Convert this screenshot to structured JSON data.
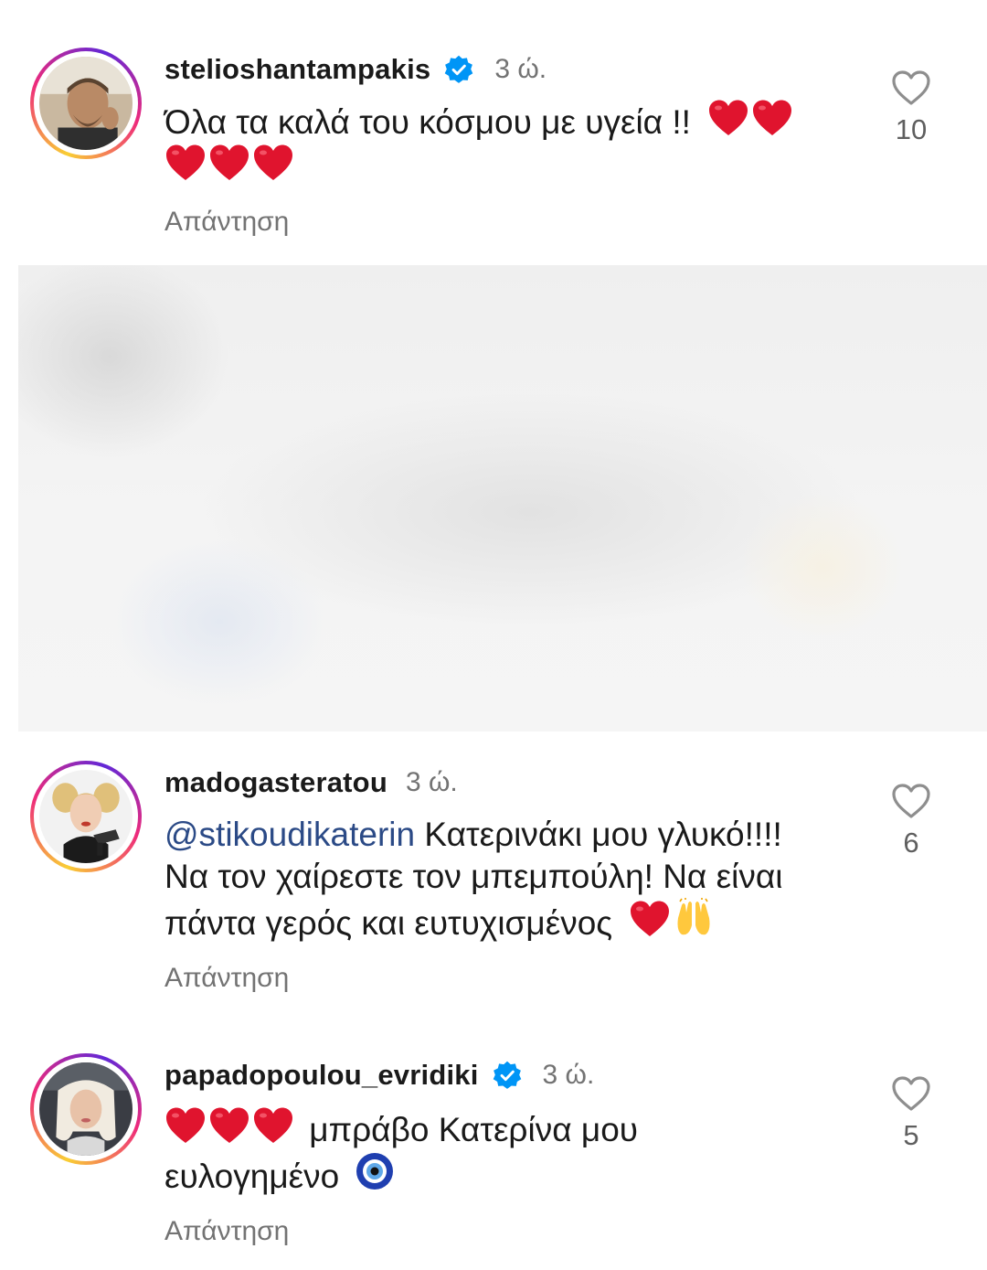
{
  "comments": [
    {
      "username": "stelioshantampakis",
      "verified": true,
      "time": "3 ώ.",
      "line1": "Όλα τα καλά του κόσμου με υγεία !!",
      "reply": "Απάντηση",
      "likes": "10"
    },
    {
      "username": "madogasteratou",
      "verified": false,
      "time": "3 ώ.",
      "mention": "@stikoudikaterin",
      "line1": "Κατερινάκι μου γλυκό!!!!",
      "line2": "Να τον χαίρεστε τον μπεμπούλη! Να είναι",
      "line3": "πάντα γερός και ευτυχισμένος",
      "reply": "Απάντηση",
      "likes": "6"
    },
    {
      "username": "papadopoulou_evridiki",
      "verified": true,
      "time": "3 ώ.",
      "line1": "μπράβο Κατερίνα μου",
      "line2": "ευλογημένο",
      "reply": "Απάντηση",
      "likes": "5"
    }
  ],
  "icons": {
    "verified": "verified-badge-icon",
    "like": "heart-outline-icon",
    "heart_emoji": "red-heart-emoji",
    "raised_hands_emoji": "raising-hands-emoji",
    "evil_eye_emoji": "nazar-amulet-emoji"
  },
  "colors": {
    "verified": "#0095f6",
    "mention": "#2b4a86",
    "muted": "#737373",
    "heart": "#e0142e"
  }
}
